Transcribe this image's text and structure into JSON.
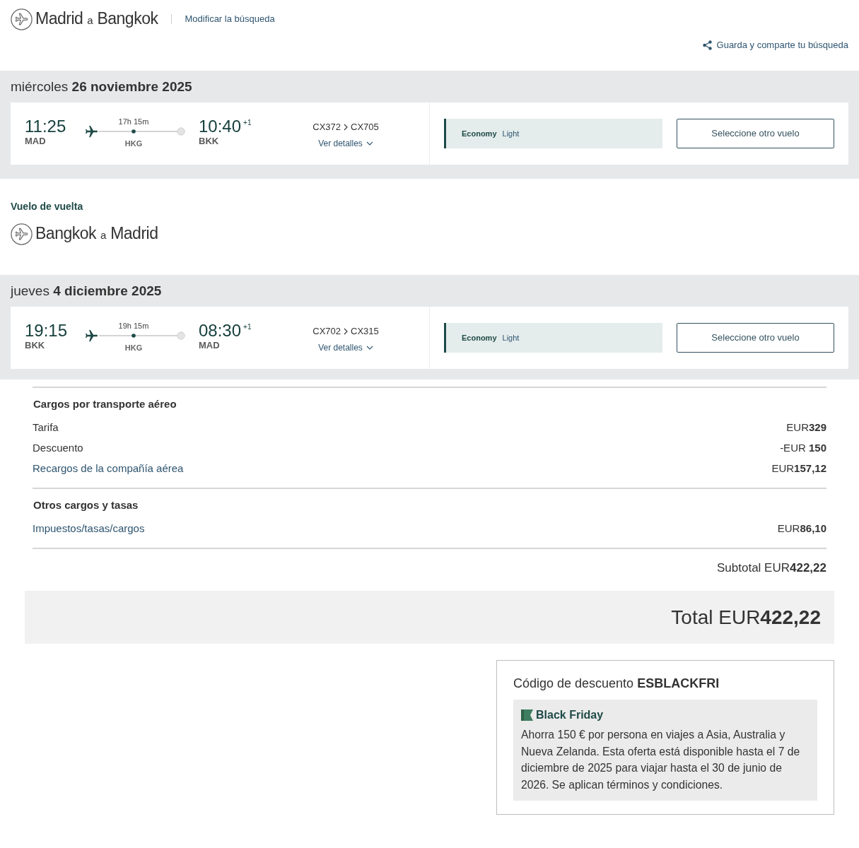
{
  "legs": [
    {
      "route": {
        "from": "Madrid",
        "joiner": "a",
        "to": "Bangkok"
      },
      "modify_link": "Modificar la búsqueda",
      "share_link": "Guarda y comparte tu búsqueda",
      "date": "miércoles **26 noviembre 2025**",
      "flight": {
        "depart": {
          "time": "11:25",
          "airport": "MAD"
        },
        "duration": "17h 15m",
        "stop": "HKG",
        "arrive": {
          "time": "10:40",
          "day_offset": "+1",
          "airport": "BKK"
        },
        "flight_numbers": [
          "CX372",
          "CX705"
        ],
        "details_link": "Ver detalles"
      },
      "fare": {
        "cabin": "Economy",
        "fare": "Light"
      },
      "button": "Seleccione otro vuelo"
    },
    {
      "label": "Vuelo de vuelta",
      "route": {
        "from": "Bangkok",
        "joiner": "a",
        "to": "Madrid"
      },
      "date": "jueves **4 diciembre 2025**",
      "flight": {
        "depart": {
          "time": "19:15",
          "airport": "BKK"
        },
        "duration": "19h 15m",
        "stop": "HKG",
        "arrive": {
          "time": "08:30",
          "day_offset": "+1",
          "airport": "MAD"
        },
        "flight_numbers": [
          "CX702",
          "CX315"
        ],
        "details_link": "Ver detalles"
      },
      "fare": {
        "cabin": "Economy",
        "fare": "Light"
      },
      "button": "Seleccione otro vuelo"
    }
  ],
  "charges": {
    "sections": [
      {
        "heading": "Cargos por transporte aéreo",
        "rows": [
          {
            "kind": "text",
            "label": "Tarifa",
            "amount": "EUR**329**"
          },
          {
            "kind": "text",
            "label": "Descuento",
            "amount": "-EUR **150**"
          },
          {
            "kind": "link",
            "label": "Recargos de la compañía aérea",
            "amount": "EUR**157,12**"
          }
        ]
      },
      {
        "heading": "Otros cargos y tasas",
        "rows": [
          {
            "kind": "link",
            "label": "Impuestos/tasas/cargos",
            "amount": "EUR**86,10**"
          }
        ]
      }
    ],
    "subtotal": "Subtotal EUR**422,22**",
    "total": "Total EUR**422,22**"
  },
  "promo": {
    "title": "Código de descuento **ESBLACKFRI**",
    "name": "Black Friday",
    "text": "Ahorra 150 € por persona en viajes a Asia, Australia y Nueva Zelanda. Esta oferta está disponible hasta el 7 de diciembre de 2025 para viajar hasta el 30 de junio de 2026. Se aplican términos y condiciones."
  }
}
